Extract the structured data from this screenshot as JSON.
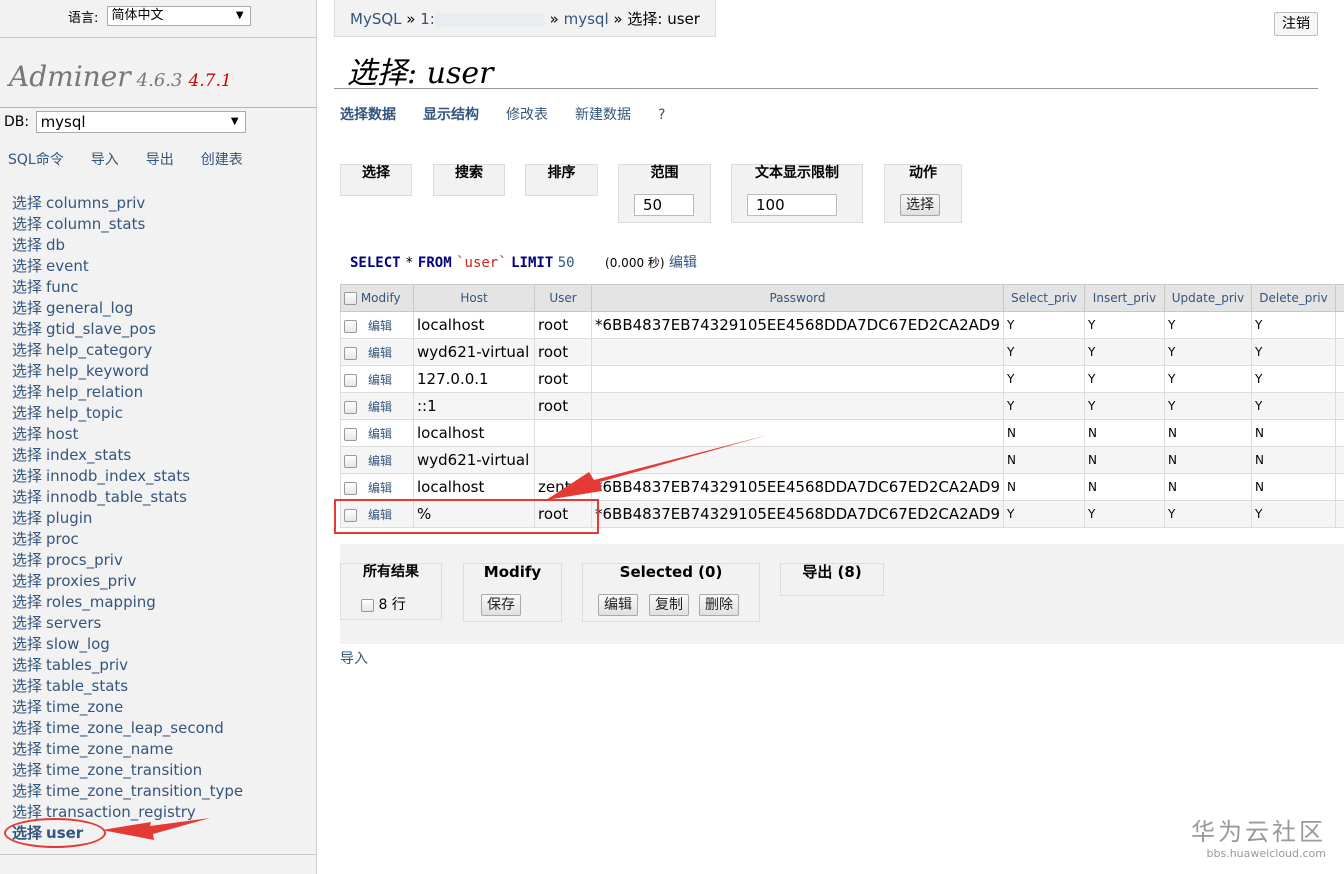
{
  "menu": {
    "lang_label": "语言:",
    "lang_value": "简体中文",
    "logo": {
      "name": "Adminer",
      "version": "4.6.3",
      "new_version": "4.7.1"
    },
    "db_label": "DB:",
    "db_value": "mysql",
    "db_links": [
      "SQL命令",
      "导入",
      "导出",
      "创建表"
    ],
    "table_prefix": "选择",
    "tables": [
      "columns_priv",
      "column_stats",
      "db",
      "event",
      "func",
      "general_log",
      "gtid_slave_pos",
      "help_category",
      "help_keyword",
      "help_relation",
      "help_topic",
      "host",
      "index_stats",
      "innodb_index_stats",
      "innodb_table_stats",
      "plugin",
      "proc",
      "procs_priv",
      "proxies_priv",
      "roles_mapping",
      "servers",
      "slow_log",
      "tables_priv",
      "table_stats",
      "time_zone",
      "time_zone_leap_second",
      "time_zone_name",
      "time_zone_transition",
      "time_zone_transition_type",
      "transaction_registry",
      "user"
    ]
  },
  "breadcrumb": {
    "part1": "MySQL",
    "sep": "»",
    "part2": "1:",
    "part3": "mysql",
    "part4": "选择: user"
  },
  "logout": "注销",
  "title": "选择: user",
  "tabs": [
    "选择数据",
    "显示结构",
    "修改表",
    "新建数据",
    "?"
  ],
  "filters": {
    "select": "选择",
    "search": "搜索",
    "sort": "排序",
    "range_label": "范围",
    "range_value": "50",
    "text_limit_label": "文本显示限制",
    "text_limit_value": "100",
    "action_label": "动作",
    "action_button": "选择"
  },
  "sql": {
    "kw_select": "SELECT",
    "star": "*",
    "kw_from": "FROM",
    "table": "`user`",
    "kw_limit": "LIMIT",
    "limit": "50",
    "time": "(0.000 秒)",
    "edit": "编辑"
  },
  "grid": {
    "edit_label": "编辑",
    "headers": [
      "Modify",
      "Host",
      "User",
      "Password",
      "Select_priv",
      "Insert_priv",
      "Update_priv",
      "Delete_priv"
    ],
    "rows": [
      {
        "host": "localhost",
        "user": "root",
        "password": "*6BB4837EB74329105EE4568DDA7DC67ED2CA2AD9",
        "privs": [
          "Y",
          "Y",
          "Y",
          "Y"
        ]
      },
      {
        "host": "wyd621-virtual",
        "user": "root",
        "password": "",
        "privs": [
          "Y",
          "Y",
          "Y",
          "Y"
        ]
      },
      {
        "host": "127.0.0.1",
        "user": "root",
        "password": "",
        "privs": [
          "Y",
          "Y",
          "Y",
          "Y"
        ]
      },
      {
        "host": "::1",
        "user": "root",
        "password": "",
        "privs": [
          "Y",
          "Y",
          "Y",
          "Y"
        ]
      },
      {
        "host": "localhost",
        "user": "",
        "password": "",
        "privs": [
          "N",
          "N",
          "N",
          "N"
        ]
      },
      {
        "host": "wyd621-virtual",
        "user": "",
        "password": "",
        "privs": [
          "N",
          "N",
          "N",
          "N"
        ]
      },
      {
        "host": "localhost",
        "user": "zent",
        "password": "*6BB4837EB74329105EE4568DDA7DC67ED2CA2AD9",
        "privs": [
          "N",
          "N",
          "N",
          "N"
        ]
      },
      {
        "host": "%",
        "user": "root",
        "password": "*6BB4837EB74329105EE4568DDA7DC67ED2CA2AD9",
        "privs": [
          "Y",
          "Y",
          "Y",
          "Y"
        ]
      }
    ]
  },
  "bottom": {
    "all_results": "所有结果",
    "rows_count": "8 行",
    "modify": "Modify",
    "save": "保存",
    "selected": "Selected (0)",
    "edit": "编辑",
    "copy": "复制",
    "delete": "删除",
    "export": "导出 (8)"
  },
  "import_link": "导入",
  "watermark": {
    "big": "华为云社区",
    "small": "bbs.huaweicloud.com"
  },
  "colors": {
    "link": "#34567c",
    "highlight": "#e53935",
    "sql_keyword": "#000080",
    "sql_table": "#cc2222",
    "new_version": "#cc0000"
  }
}
